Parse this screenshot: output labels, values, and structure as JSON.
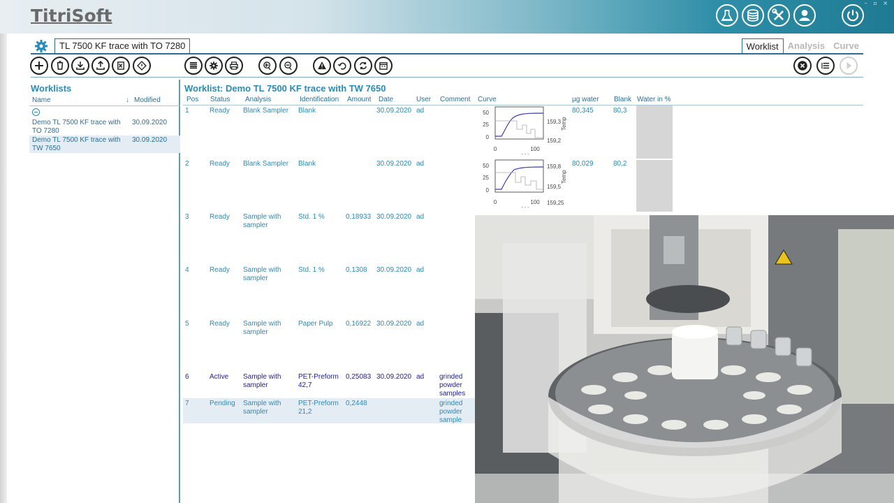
{
  "app": {
    "title": "TitriSoft"
  },
  "header_icons": [
    "flask-icon",
    "database-icon",
    "tools-icon",
    "user-icon",
    "power-icon"
  ],
  "document_tab": {
    "label": "TL 7500 KF trace with TO 7280"
  },
  "view_tabs": [
    {
      "label": "Worklist",
      "active": true
    },
    {
      "label": "Analysis",
      "active": false
    },
    {
      "label": "Curve",
      "active": false
    }
  ],
  "toolbar_icons": [
    "add-icon",
    "delete-icon",
    "import-icon",
    "export-icon",
    "excel-icon",
    "move-icon",
    "list-icon",
    "settings-icon",
    "print-icon",
    "sampler-icon",
    "sampler-reset-icon",
    "warning-icon",
    "undo-icon",
    "refresh-icon",
    "calendar-icon",
    "cancel-icon",
    "list-menu-icon",
    "play-icon"
  ],
  "left_panel": {
    "title": "Worklists",
    "headers": {
      "name": "Name",
      "modified": "Modified"
    },
    "items": [
      {
        "name": "Demo TL 7500 KF trace with TO 7280",
        "date": "30.09.2020",
        "selected": false
      },
      {
        "name": "Demo TL 7500 KF trace with TW 7650",
        "date": "30.09.2020",
        "selected": true
      }
    ]
  },
  "worklist": {
    "title": "Worklist: Demo TL 7500 KF trace with TW 7650",
    "headers": {
      "pos": "Pos",
      "status": "Status",
      "analysis": "Analysis",
      "identification": "Identification",
      "amount": "Amount",
      "date": "Date",
      "user": "User",
      "comment": "Comment",
      "curve": "Curve",
      "water_ug": "µg water",
      "blank": "Blank",
      "water_pct": "Water in %"
    },
    "rows": [
      {
        "pos": "1",
        "status": "Ready",
        "analysis": "Blank Sampler",
        "identification": "Blank",
        "amount": "",
        "date": "30.09.2020",
        "user": "ad",
        "comment": "",
        "water_ug": "80,345",
        "blank": "80,3"
      },
      {
        "pos": "2",
        "status": "Ready",
        "analysis": "Blank Sampler",
        "identification": "Blank",
        "amount": "",
        "date": "30.09.2020",
        "user": "ad",
        "comment": "",
        "water_ug": "80,029",
        "blank": "80,2"
      },
      {
        "pos": "3",
        "status": "Ready",
        "analysis": "Sample with sampler",
        "identification": "Std. 1 %",
        "amount": "0,18933",
        "date": "30.09.2020",
        "user": "ad",
        "comment": ""
      },
      {
        "pos": "4",
        "status": "Ready",
        "analysis": "Sample with sampler",
        "identification": "Std. 1 %",
        "amount": "0,1308",
        "date": "30.09.2020",
        "user": "ad",
        "comment": ""
      },
      {
        "pos": "5",
        "status": "Ready",
        "analysis": "Sample with sampler",
        "identification": "Paper Pulp",
        "amount": "0,16922",
        "date": "30.09.2020",
        "user": "ad",
        "comment": ""
      },
      {
        "pos": "6",
        "status": "Active",
        "analysis": "Sample with sampler",
        "identification": "PET-Preform 42,7",
        "amount": "0,25083",
        "date": "30.09.2020",
        "user": "ad",
        "comment": "grinded powder samples"
      },
      {
        "pos": "7",
        "status": "Pending",
        "analysis": "Sample with sampler",
        "identification": "PET-Preform 21,2",
        "amount": "0,2448",
        "date": "",
        "user": "",
        "comment": "grinded powder sample"
      }
    ],
    "curves": [
      {
        "y_ticks": [
          "50",
          "25",
          "0"
        ],
        "right_ticks": [
          "159,3",
          "159,2"
        ],
        "x_ticks": [
          "0",
          "100"
        ],
        "x_label": "sec",
        "right_label": "Temp"
      },
      {
        "y_ticks": [
          "50",
          "25",
          "0"
        ],
        "right_ticks": [
          "159,8",
          "159,5",
          "159,25"
        ],
        "x_ticks": [
          "0",
          "100"
        ],
        "x_label": "sec",
        "right_label": "Temp"
      }
    ]
  },
  "colors": {
    "accent": "#2a8ab8",
    "active_row": "#1b1baa",
    "selected_bg": "#e5edf4",
    "header_dark": "#1f7a93"
  }
}
